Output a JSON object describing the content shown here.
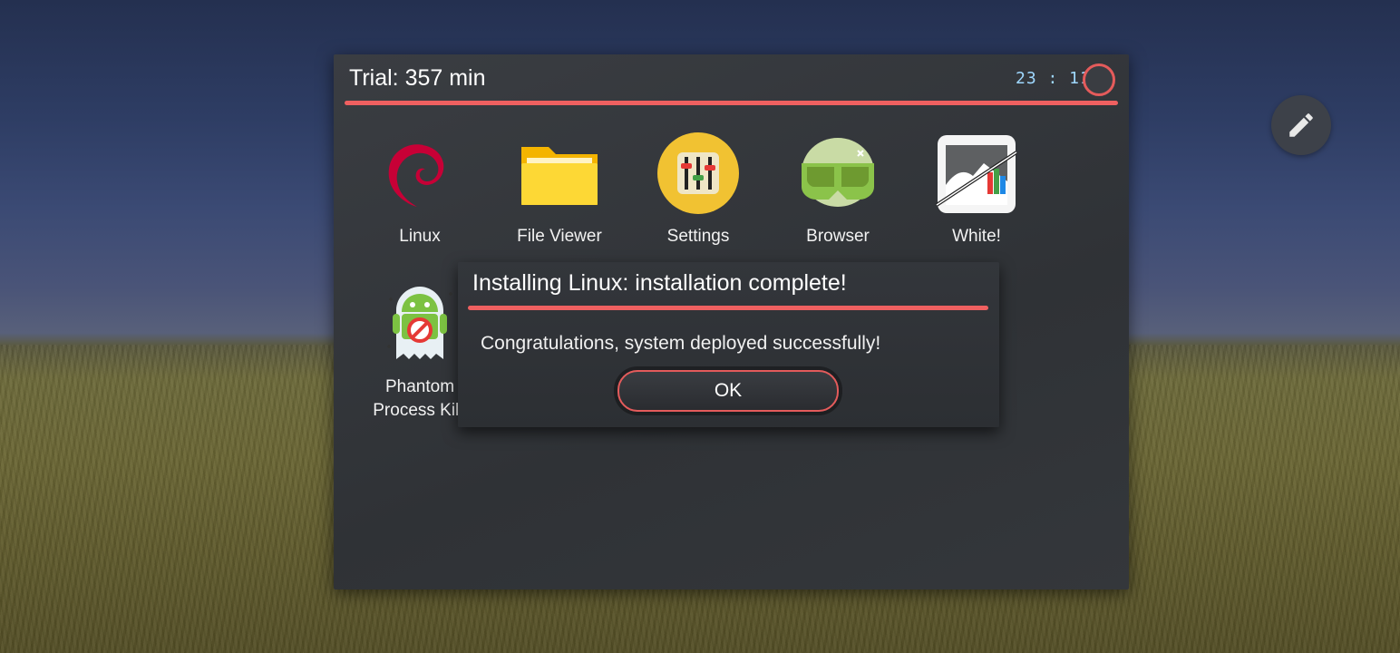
{
  "titlebar": {
    "trial_text": "Trial: 357 min",
    "clock": "23 : 11"
  },
  "apps": [
    {
      "label": "Linux",
      "icon": "debian-swirl-icon"
    },
    {
      "label": "File Viewer",
      "icon": "folder-icon"
    },
    {
      "label": "Settings",
      "icon": "equalizer-sliders-icon"
    },
    {
      "label": "Browser",
      "icon": "green-goggles-icon"
    },
    {
      "label": "White!",
      "icon": "tv-screen-icon"
    },
    {
      "label_line1": "Phantom",
      "label_line2": "Process Killi",
      "icon": "android-ghost-icon"
    }
  ],
  "dialog": {
    "title": "Installing Linux: installation complete!",
    "message": "Congratulations, system deployed successfully!",
    "ok_label": "OK"
  },
  "colors": {
    "accent": "#ef6060",
    "clock": "#9fd8ff",
    "panel": "#33363b"
  }
}
